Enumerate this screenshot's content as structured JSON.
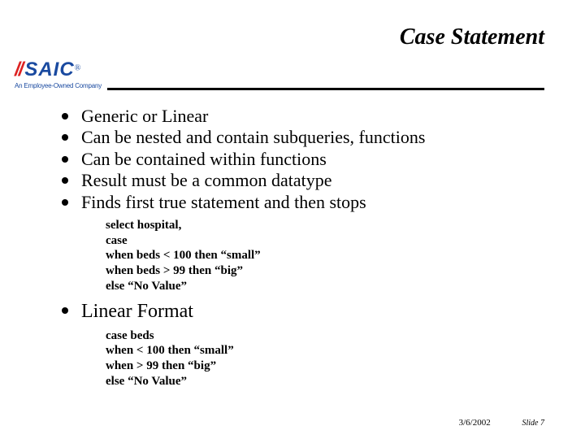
{
  "header": {
    "title": "Case Statement",
    "logo_slash": "//",
    "logo_text": "SAIC",
    "logo_reg": "®",
    "logo_tagline": "An Employee-Owned Company"
  },
  "bullets_top": [
    "Generic or Linear",
    "Can be nested and contain subqueries, functions",
    "Can be contained within functions",
    "Result must be a common datatype",
    "Finds first true statement and then stops"
  ],
  "code1": "select hospital,\ncase\nwhen beds < 100 then “small”\nwhen beds > 99 then “big”\nelse “No Value”",
  "bullets_bottom": [
    "Linear Format"
  ],
  "code2": "case beds\nwhen < 100 then “small”\nwhen > 99 then “big”\nelse “No Value”",
  "footer": {
    "date": "3/6/2002",
    "slide_label": "Slide 7"
  }
}
